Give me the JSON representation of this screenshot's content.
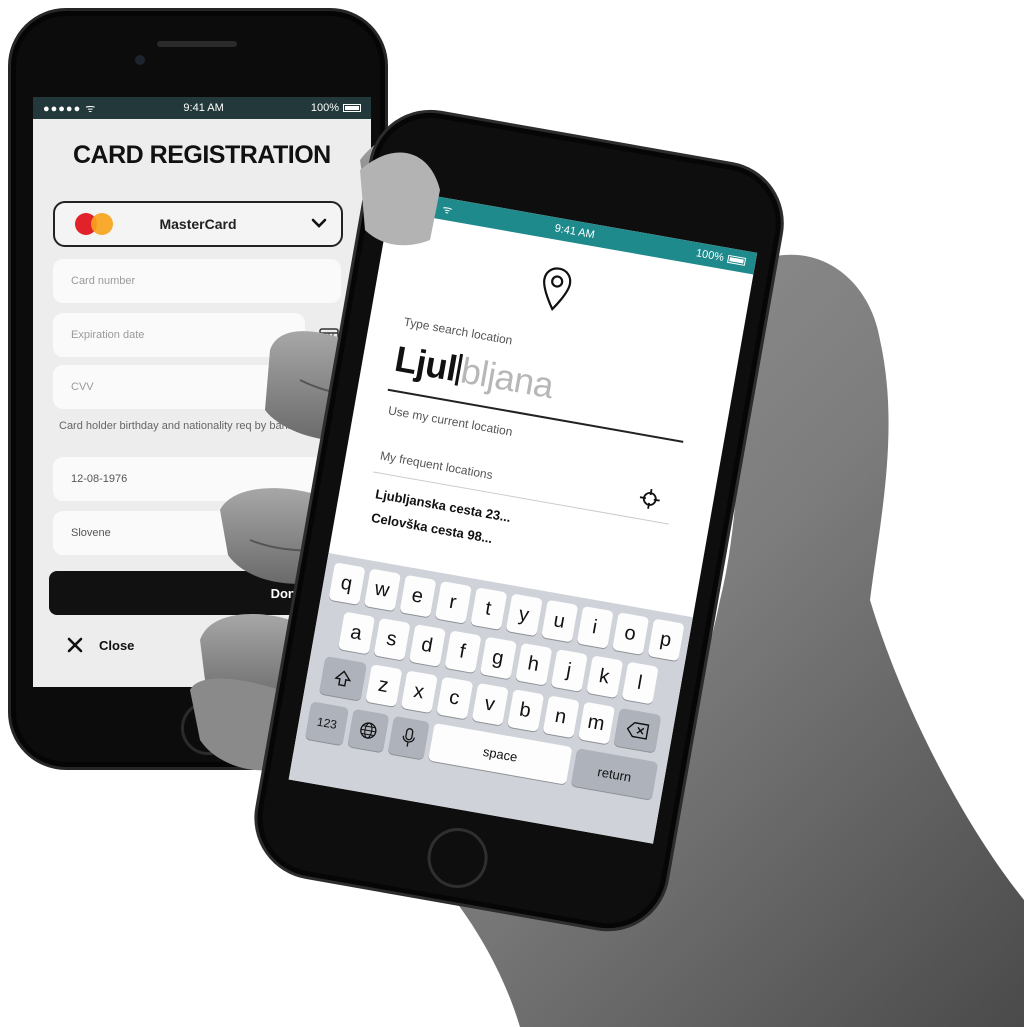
{
  "back_phone": {
    "status": {
      "signal": "●●●●● ᯤ",
      "time": "9:41 AM",
      "battery": "100%"
    },
    "title": "CARD REGISTRATION",
    "card_select": {
      "value": "MasterCard",
      "logo_text": "MasterCard"
    },
    "fields": {
      "card_number": {
        "placeholder": "Card number"
      },
      "expiration": {
        "placeholder": "Expiration date"
      },
      "cvv": {
        "placeholder": "CVV"
      },
      "birthday": {
        "value": "12-08-1976"
      },
      "nationality": {
        "value": "Slovene"
      }
    },
    "fraud_note": "Card holder birthday and nationality req by bank to prevent fraud:",
    "done_label": "Done!",
    "close_label": "Close"
  },
  "front_phone": {
    "status": {
      "signal": "●●●●● ᯤ",
      "time": "9:41 AM",
      "battery": "100%"
    },
    "search_label": "Type search location",
    "typed_text": "Ljul",
    "suggestion_text": "bljana",
    "use_location_label": "Use my current location",
    "frequent_label": "My frequent locations",
    "frequent_locations": [
      "Ljubljanska cesta 23...",
      "Celovška cesta 98..."
    ],
    "keyboard": {
      "row1": [
        "q",
        "w",
        "e",
        "r",
        "t",
        "y",
        "u",
        "i",
        "o",
        "p"
      ],
      "row2": [
        "a",
        "s",
        "d",
        "f",
        "g",
        "h",
        "j",
        "k",
        "l"
      ],
      "row3": [
        "z",
        "x",
        "c",
        "v",
        "b",
        "n",
        "m"
      ],
      "num_key": "123",
      "space_key": "space",
      "return_key": "return"
    }
  },
  "colors": {
    "teal_accent": "#1f8a8c",
    "mastercard_red": "#e2222b",
    "mastercard_orange": "#f6a31b"
  }
}
